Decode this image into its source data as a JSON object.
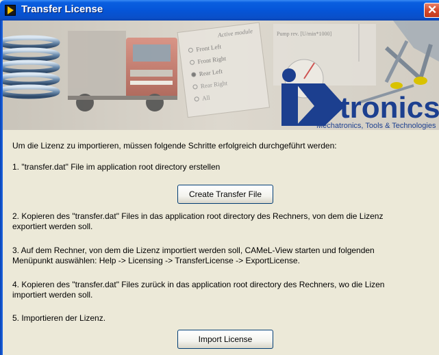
{
  "window": {
    "title": "Transfer License",
    "close_glyph": "✕"
  },
  "banner": {
    "logo_brand": "tronics",
    "logo_tagline": "Mechatronics, Tools & Technologies",
    "panel_title": "Active module",
    "panel_options": [
      "Front Left",
      "Front Right",
      "Rear Left",
      "Rear Right",
      "All"
    ],
    "pump_label": "Pump rev. [U/min*1000]"
  },
  "content": {
    "intro": "Um die Lizenz zu importieren, müssen folgende Schritte erfolgreich durchgeführt werden:",
    "step1": "1. \"transfer.dat\" File im application root directory erstellen",
    "create_button": "Create Transfer File",
    "step2_line1": "2. Kopieren des \"transfer.dat\" Files in das application root directory des Rechners, von dem die Lizenz",
    "step2_line2": "exportiert werden soll.",
    "step3_line1": "3. Auf dem Rechner, von dem die Lizenz importiert werden soll, CAMeL-View starten und folgenden",
    "step3_line2": "Menüpunkt auswählen: Help -> Licensing -> TransferLicense -> ExportLicense.",
    "step4_line1": "4. Kopieren des \"transfer.dat\" Files zurück in das application root directory des Rechners, wo die Lizen",
    "step4_line2": "importiert werden soll.",
    "step5": "5. Importieren der Lizenz.",
    "import_button": "Import License"
  }
}
